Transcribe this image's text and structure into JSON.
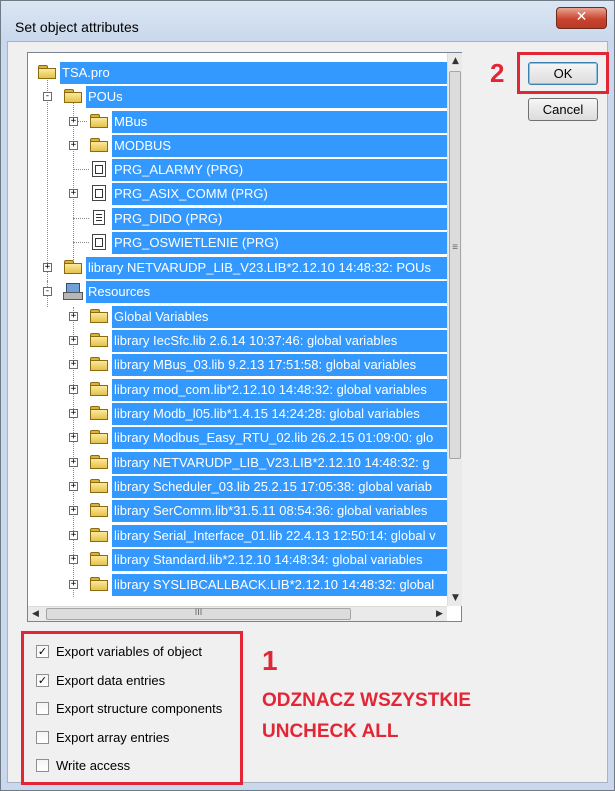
{
  "window": {
    "title": "Set object attributes",
    "close_glyph": "✕"
  },
  "buttons": {
    "ok_label": "OK",
    "cancel_label": "Cancel"
  },
  "tree": {
    "items": [
      {
        "label": "TSA.pro",
        "icon": "folder-open-icon",
        "expander": ""
      },
      {
        "label": "POUs",
        "icon": "folder-open-icon",
        "expander": "-"
      },
      {
        "label": "MBus",
        "icon": "folder-icon",
        "expander": "+"
      },
      {
        "label": "MODBUS",
        "icon": "folder-icon",
        "expander": "+"
      },
      {
        "label": "PRG_ALARMY (PRG)",
        "icon": "program-icon",
        "expander": ""
      },
      {
        "label": "PRG_ASIX_COMM (PRG)",
        "icon": "program-icon",
        "expander": "+"
      },
      {
        "label": "PRG_DIDO (PRG)",
        "icon": "document-icon",
        "expander": ""
      },
      {
        "label": "PRG_OSWIETLENIE (PRG)",
        "icon": "program-icon",
        "expander": ""
      },
      {
        "label": "library NETVARUDP_LIB_V23.LIB*2.12.10 14:48:32: POUs",
        "icon": "folder-icon",
        "expander": "+"
      },
      {
        "label": "Resources",
        "icon": "resources-icon",
        "expander": "-"
      },
      {
        "label": "Global Variables",
        "icon": "folder-icon",
        "expander": "+"
      },
      {
        "label": "library IecSfc.lib 2.6.14 10:37:46: global variables",
        "icon": "folder-icon",
        "expander": "+"
      },
      {
        "label": "library MBus_03.lib 9.2.13 17:51:58: global variables",
        "icon": "folder-icon",
        "expander": "+"
      },
      {
        "label": "library mod_com.lib*2.12.10 14:48:32: global variables",
        "icon": "folder-icon",
        "expander": "+"
      },
      {
        "label": "library Modb_l05.lib*1.4.15 14:24:28: global variables",
        "icon": "folder-icon",
        "expander": "+"
      },
      {
        "label": "library Modbus_Easy_RTU_02.lib 26.2.15 01:09:00: glo",
        "icon": "folder-icon",
        "expander": "+"
      },
      {
        "label": "library NETVARUDP_LIB_V23.LIB*2.12.10 14:48:32: g",
        "icon": "folder-icon",
        "expander": "+"
      },
      {
        "label": "library Scheduler_03.lib 25.2.15 17:05:38: global variab",
        "icon": "folder-icon",
        "expander": "+"
      },
      {
        "label": "library SerComm.lib*31.5.11 08:54:36: global variables",
        "icon": "folder-icon",
        "expander": "+"
      },
      {
        "label": "library Serial_Interface_01.lib 22.4.13 12:50:14: global v",
        "icon": "folder-icon",
        "expander": "+"
      },
      {
        "label": "library Standard.lib*2.12.10 14:48:34: global variables",
        "icon": "folder-icon",
        "expander": "+"
      },
      {
        "label": "library SYSLIBCALLBACK.LIB*2.12.10 14:48:32: global",
        "icon": "folder-icon",
        "expander": "+"
      }
    ]
  },
  "scroll": {
    "up": "▲",
    "down": "▼",
    "left": "◀",
    "right": "▶",
    "grip_v": "≡",
    "grip_h": "III"
  },
  "options": [
    {
      "label": "Export variables of object",
      "checked": true,
      "mark": "✓"
    },
    {
      "label": "Export data entries",
      "checked": true,
      "mark": "✓"
    },
    {
      "label": "Export structure components",
      "checked": false,
      "mark": ""
    },
    {
      "label": "Export array entries",
      "checked": false,
      "mark": ""
    },
    {
      "label": "Write access",
      "checked": false,
      "mark": ""
    }
  ],
  "annotations": {
    "step_ok": "2",
    "step_options": "1",
    "instruction_pl": "ODZNACZ WSZYSTKIE",
    "instruction_en": "UNCHECK ALL",
    "color": "#e32636"
  }
}
